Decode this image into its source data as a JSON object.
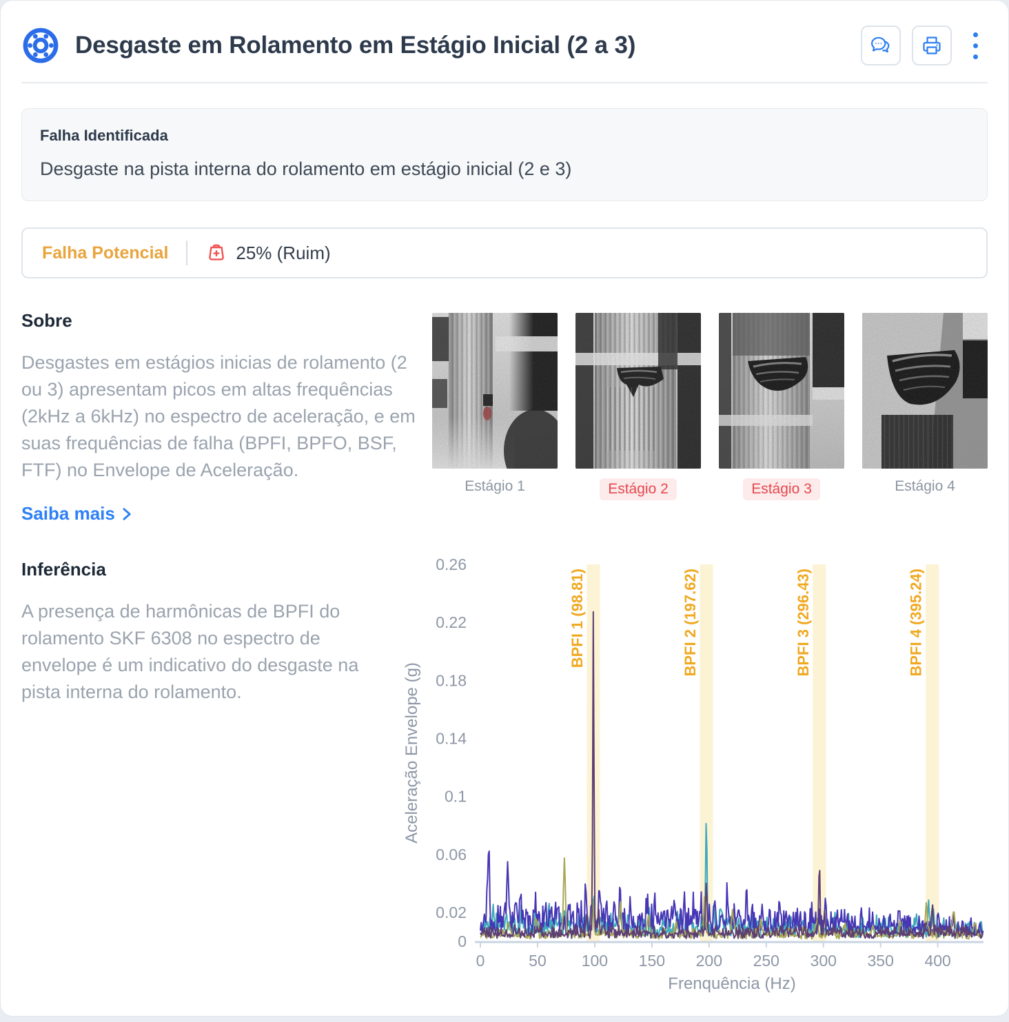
{
  "header": {
    "title": "Desgaste em Rolamento em Estágio Inicial (2 a 3)",
    "icons": {
      "logo": "bearing-icon",
      "chat": "chat-icon",
      "print": "printer-icon",
      "menu": "kebab-menu-icon"
    }
  },
  "fault_panel": {
    "title": "Falha Identificada",
    "description": "Desgaste na pista interna do rolamento em estágio inicial (2 e 3)"
  },
  "status_bar": {
    "label": "Falha Potencial",
    "health_icon": "first-aid-bag-icon",
    "severity": "25% (Ruim)"
  },
  "about": {
    "heading": "Sobre",
    "body": "Desgastes em estágios inicias de rolamento (2 ou 3) apresentam picos em altas frequências (2kHz a 6kHz) no espectro de aceleração, e em suas frequências de falha (BPFI, BPFO, BSF, FTF) no Envelope de Aceleração.",
    "link_label": "Saiba mais"
  },
  "stages": [
    {
      "label": "Estágio 1",
      "flagged": false
    },
    {
      "label": "Estágio 2",
      "flagged": true
    },
    {
      "label": "Estágio 3",
      "flagged": true
    },
    {
      "label": "Estágio 4",
      "flagged": false
    }
  ],
  "inference": {
    "heading": "Inferência",
    "body": "A presença de harmônicas de BPFI do rolamento SKF 6308 no espectro de envelope é um indicativo do desgaste na pista interna do rolamento."
  },
  "colors": {
    "accent_blue": "#2d7ff0",
    "amber": "#e9a43c",
    "red": "#ef5350",
    "stage_red": "#e5484d"
  },
  "chart_data": {
    "type": "line",
    "xlabel": "Frenquência (Hz)",
    "ylabel": "Aceleração Envelope (g)",
    "xlim": [
      0,
      440
    ],
    "ylim": [
      0,
      0.26
    ],
    "xticks": [
      0,
      50,
      100,
      150,
      200,
      250,
      300,
      350,
      400
    ],
    "yticks": [
      0,
      0.02,
      0.06,
      0.1,
      0.14,
      0.18,
      0.22,
      0.26
    ],
    "grid": false,
    "legend": "none",
    "band_color": "#fcf2d4",
    "band_label_color": "#f0a81f",
    "axis_text_color": "#8d97a6",
    "axis_line_color": "#c9d4e3",
    "highlight_bands": [
      {
        "label": "BPFI 1 (98.81)",
        "freq": 98.81
      },
      {
        "label": "BPFI 2 (197.62)",
        "freq": 197.62
      },
      {
        "label": "BPFI 3 (296.43)",
        "freq": 296.43
      },
      {
        "label": "BPFI 4 (395.24)",
        "freq": 395.24
      }
    ],
    "series": [
      {
        "name": "envelope-teal",
        "color": "#3ea8bc",
        "baseline": 0.007,
        "noise": 0.007,
        "taper": [
          220,
          0.7
        ],
        "peaks": [
          [
            12,
            0.01,
            1.2
          ],
          [
            22,
            0.006,
            1.0
          ],
          [
            36,
            0.006,
            1.0
          ],
          [
            48,
            0.009,
            1.0
          ],
          [
            60,
            0.006,
            1.0
          ],
          [
            74,
            0.008,
            0.9
          ],
          [
            86,
            0.006,
            0.9
          ],
          [
            98.8,
            0.02,
            0.9
          ],
          [
            105,
            0.008,
            0.9
          ],
          [
            122,
            0.008,
            0.9
          ],
          [
            135,
            0.006,
            0.9
          ],
          [
            148,
            0.009,
            0.9
          ],
          [
            160,
            0.007,
            0.9
          ],
          [
            172,
            0.011,
            0.9
          ],
          [
            184,
            0.007,
            0.9
          ],
          [
            197.62,
            0.08,
            0.8
          ],
          [
            204,
            0.012,
            0.9
          ],
          [
            210,
            0.011,
            0.9
          ],
          [
            217,
            0.008,
            0.9
          ],
          [
            222,
            0.008,
            0.9
          ],
          [
            235,
            0.006,
            0.9
          ],
          [
            247,
            0.006,
            0.9
          ],
          [
            272,
            0.004,
            0.9
          ],
          [
            284,
            0.004,
            0.9
          ],
          [
            296,
            0.006,
            0.9
          ],
          [
            310,
            0.004,
            0.9
          ],
          [
            322,
            0.004,
            0.9
          ],
          [
            334,
            0.004,
            0.9
          ],
          [
            347,
            0.004,
            0.9
          ],
          [
            358,
            0.005,
            0.9
          ],
          [
            370,
            0.008,
            0.9
          ],
          [
            381,
            0.005,
            0.9
          ],
          [
            392,
            0.024,
            0.9
          ],
          [
            396,
            0.016,
            0.9
          ],
          [
            405,
            0.009,
            0.9
          ],
          [
            415,
            0.007,
            0.9
          ],
          [
            425,
            0.005,
            0.9
          ]
        ]
      },
      {
        "name": "envelope-indigo",
        "color": "#4636b4",
        "baseline": 0.009,
        "noise": 0.01,
        "taper": [
          240,
          0.55
        ],
        "peaks": [
          [
            7,
            0.05,
            1.2
          ],
          [
            24,
            0.035,
            1.0
          ],
          [
            31,
            0.015,
            1.0
          ],
          [
            35,
            0.022,
            0.9
          ],
          [
            48,
            0.01,
            1.0
          ],
          [
            57,
            0.012,
            0.9
          ],
          [
            66,
            0.01,
            0.9
          ],
          [
            80,
            0.01,
            0.9
          ],
          [
            92,
            0.028,
            0.9
          ],
          [
            97,
            0.016,
            0.8
          ],
          [
            104,
            0.022,
            0.9
          ],
          [
            110,
            0.016,
            0.9
          ],
          [
            117,
            0.012,
            0.9
          ],
          [
            122,
            0.022,
            0.9
          ],
          [
            131,
            0.017,
            0.9
          ],
          [
            139,
            0.01,
            0.9
          ],
          [
            146,
            0.012,
            0.9
          ],
          [
            153,
            0.01,
            0.9
          ],
          [
            158,
            0.011,
            0.9
          ],
          [
            165,
            0.01,
            0.9
          ],
          [
            170,
            0.02,
            0.9
          ],
          [
            178,
            0.012,
            0.9
          ],
          [
            186,
            0.01,
            0.9
          ],
          [
            193,
            0.015,
            0.9
          ],
          [
            200,
            0.01,
            0.9
          ],
          [
            205,
            0.012,
            0.9
          ],
          [
            211,
            0.01,
            0.9
          ],
          [
            216,
            0.015,
            0.9
          ],
          [
            222,
            0.01,
            0.9
          ],
          [
            226,
            0.016,
            0.9
          ],
          [
            233,
            0.011,
            0.9
          ],
          [
            238,
            0.009,
            0.9
          ],
          [
            247,
            0.008,
            0.9
          ],
          [
            253,
            0.011,
            0.9
          ],
          [
            262,
            0.007,
            0.9
          ],
          [
            270,
            0.006,
            0.9
          ],
          [
            280,
            0.008,
            0.9
          ],
          [
            290,
            0.006,
            0.9
          ],
          [
            302,
            0.013,
            0.9
          ],
          [
            308,
            0.008,
            0.9
          ],
          [
            312,
            0.01,
            0.9
          ],
          [
            318,
            0.006,
            0.9
          ],
          [
            325,
            0.008,
            0.9
          ],
          [
            333,
            0.006,
            0.9
          ],
          [
            340,
            0.006,
            0.9
          ],
          [
            349,
            0.008,
            0.9
          ],
          [
            358,
            0.008,
            0.9
          ],
          [
            366,
            0.006,
            0.9
          ],
          [
            374,
            0.006,
            0.9
          ],
          [
            381,
            0.005,
            0.9
          ],
          [
            389,
            0.005,
            0.9
          ],
          [
            400,
            0.007,
            0.9
          ],
          [
            408,
            0.005,
            0.9
          ],
          [
            414,
            0.005,
            0.9
          ],
          [
            421,
            0.006,
            0.9
          ],
          [
            430,
            0.004,
            0.9
          ]
        ]
      },
      {
        "name": "envelope-olive",
        "color": "#a8a757",
        "baseline": 0.0035,
        "noise": 0.003,
        "taper": null,
        "peaks": [
          [
            24.5,
            0.006,
            1.4
          ],
          [
            49,
            0.012,
            1.4
          ],
          [
            73.5,
            0.051,
            1.2
          ],
          [
            98,
            0.021,
            1.2
          ],
          [
            122.5,
            0.02,
            1.3
          ],
          [
            147,
            0.012,
            1.4
          ],
          [
            171.5,
            0.01,
            1.4
          ],
          [
            196,
            0.023,
            1.2
          ],
          [
            220.5,
            0.016,
            1.4
          ],
          [
            245,
            0.008,
            1.4
          ],
          [
            269.5,
            0.006,
            1.4
          ],
          [
            294,
            0.01,
            1.4
          ],
          [
            318.5,
            0.007,
            1.4
          ],
          [
            343,
            0.007,
            1.4
          ],
          [
            367.5,
            0.007,
            1.4
          ],
          [
            390,
            0.019,
            1.3
          ],
          [
            414,
            0.016,
            1.3
          ],
          [
            432,
            0.008,
            1.3
          ]
        ]
      },
      {
        "name": "envelope-purple",
        "color": "#5d3f72",
        "baseline": 0.004,
        "noise": 0.004,
        "taper": null,
        "peaks": [
          [
            93,
            0.016,
            1.0
          ],
          [
            98.81,
            0.228,
            0.7
          ],
          [
            103.5,
            0.015,
            1.0
          ],
          [
            197.62,
            0.04,
            0.8
          ],
          [
            296.43,
            0.047,
            0.8
          ],
          [
            301,
            0.014,
            0.9
          ],
          [
            389,
            0.008,
            0.9
          ],
          [
            395.24,
            0.019,
            0.9
          ]
        ]
      }
    ]
  }
}
